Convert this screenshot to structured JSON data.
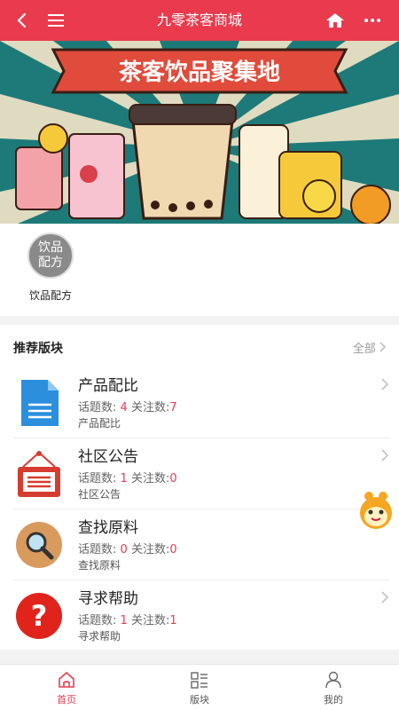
{
  "header": {
    "title": "九零茶客商城",
    "back_icon": "back-arrow-icon",
    "menu_icon": "hamburger-menu-icon",
    "home_icon": "home-icon",
    "more_icon": "more-dots-icon",
    "bg_color": "#e93a4e"
  },
  "banner": {
    "title": "茶客饮品聚集地"
  },
  "categories": [
    {
      "label": "饮品配方",
      "icon_text": "饮品配方"
    }
  ],
  "section": {
    "title": "推荐版块",
    "all_label": "全部"
  },
  "forums": [
    {
      "name": "产品配比",
      "topics_label": "话题数:",
      "topics": "4",
      "follows_label": "关注数:",
      "follows": "7",
      "desc": "产品配比",
      "icon": "document-icon"
    },
    {
      "name": "社区公告",
      "topics_label": "话题数:",
      "topics": "1",
      "follows_label": "关注数:",
      "follows": "0",
      "desc": "社区公告",
      "icon": "notice-board-icon"
    },
    {
      "name": "查找原料",
      "topics_label": "话题数:",
      "topics": "0",
      "follows_label": "关注数:",
      "follows": "0",
      "desc": "查找原料",
      "icon": "magnifier-icon"
    },
    {
      "name": "寻求帮助",
      "topics_label": "话题数:",
      "topics": "1",
      "follows_label": "关注数:",
      "follows": "1",
      "desc": "寻求帮助",
      "icon": "help-question-icon"
    }
  ],
  "tabs": [
    {
      "label": "首页",
      "icon": "home-tab-icon",
      "active": true
    },
    {
      "label": "版块",
      "icon": "blocks-tab-icon",
      "active": false
    },
    {
      "label": "我的",
      "icon": "profile-tab-icon",
      "active": false
    }
  ],
  "colors": {
    "accent": "#e93a4e",
    "highlight_number": "#e93a4e"
  }
}
